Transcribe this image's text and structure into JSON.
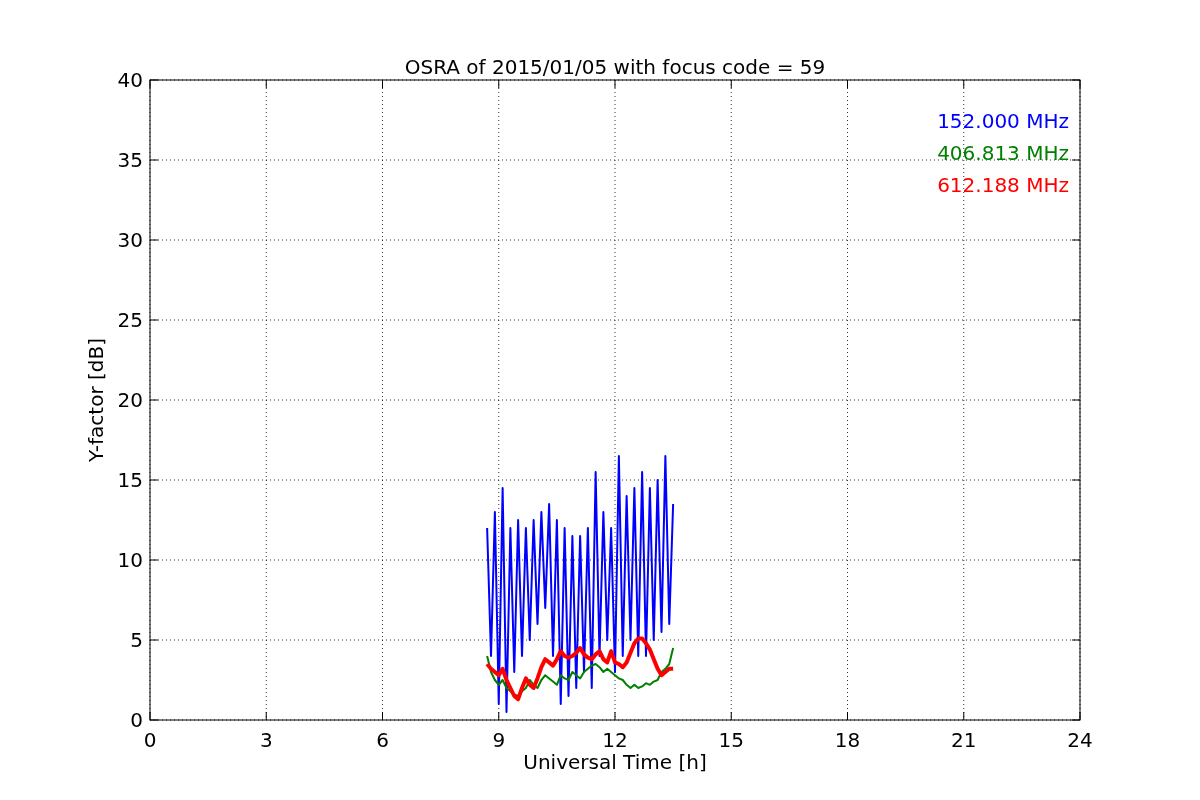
{
  "figure": {
    "chart_data": {
      "type": "line",
      "title": "OSRA of 2015/01/05 with focus code = 59",
      "xlabel": "Universal Time [h]",
      "ylabel": "Y-factor [dB]",
      "x": [
        8.7,
        8.8,
        8.9,
        9.0,
        9.1,
        9.2,
        9.3,
        9.4,
        9.5,
        9.6,
        9.7,
        9.8,
        9.9,
        10.0,
        10.1,
        10.2,
        10.3,
        10.4,
        10.5,
        10.6,
        10.7,
        10.8,
        10.9,
        11.0,
        11.1,
        11.2,
        11.3,
        11.4,
        11.5,
        11.6,
        11.7,
        11.8,
        11.9,
        12.0,
        12.1,
        12.2,
        12.3,
        12.4,
        12.5,
        12.6,
        12.7,
        12.8,
        12.9,
        13.0,
        13.1,
        13.2,
        13.3,
        13.4,
        13.5
      ],
      "series": [
        {
          "name": "152.000 MHz",
          "color": "#0000ff",
          "values": [
            12,
            4,
            13,
            1,
            14.5,
            0.5,
            12,
            3,
            12.5,
            4,
            12,
            5,
            12.5,
            6,
            13,
            7,
            13.5,
            4,
            12.5,
            1,
            12,
            1.5,
            11.5,
            2,
            11.5,
            3,
            12,
            2,
            15.5,
            4,
            13,
            5,
            12,
            3,
            16.5,
            4,
            14,
            5,
            14.5,
            4,
            15.5,
            4,
            14.5,
            5,
            15,
            5.5,
            16.5,
            6,
            13.5
          ]
        },
        {
          "name": "406.813 MHz",
          "color": "#008000",
          "values": [
            4,
            3,
            2.5,
            2.2,
            2.5,
            2,
            1.8,
            1.6,
            1.5,
            1.8,
            2,
            2.5,
            2.2,
            2,
            2.5,
            2.8,
            2.6,
            2.4,
            2.2,
            2.8,
            2.6,
            2.5,
            3,
            2.8,
            2.6,
            3,
            3.2,
            3.4,
            3.5,
            3.3,
            3,
            3.2,
            3,
            2.8,
            2.6,
            2.5,
            2.2,
            2,
            2.2,
            2,
            2.1,
            2.3,
            2.2,
            2.4,
            2.5,
            3,
            3.2,
            3.5,
            4.5
          ]
        },
        {
          "name": "612.188 MHz",
          "color": "#ff0000",
          "values": [
            3.5,
            3.2,
            3,
            2.8,
            3.2,
            2.5,
            2,
            1.5,
            1.3,
            2,
            2.6,
            2.2,
            2,
            2.6,
            3.3,
            3.8,
            3.6,
            3.4,
            3.8,
            4.3,
            4,
            3.9,
            4,
            4.2,
            4.5,
            4.1,
            3.9,
            3.8,
            4.1,
            4.3,
            3.8,
            3.6,
            4.3,
            3.6,
            3.5,
            3.3,
            3.6,
            4.2,
            4.8,
            5.1,
            5.1,
            4.8,
            4.4,
            3.8,
            3.2,
            2.8,
            3,
            3.2,
            3.2
          ]
        }
      ],
      "xlim": [
        0,
        24
      ],
      "ylim": [
        0,
        40
      ],
      "xticks": [
        0,
        3,
        6,
        9,
        12,
        15,
        18,
        21,
        24
      ],
      "yticks": [
        0,
        5,
        10,
        15,
        20,
        25,
        30,
        35,
        40
      ],
      "grid": true
    }
  }
}
